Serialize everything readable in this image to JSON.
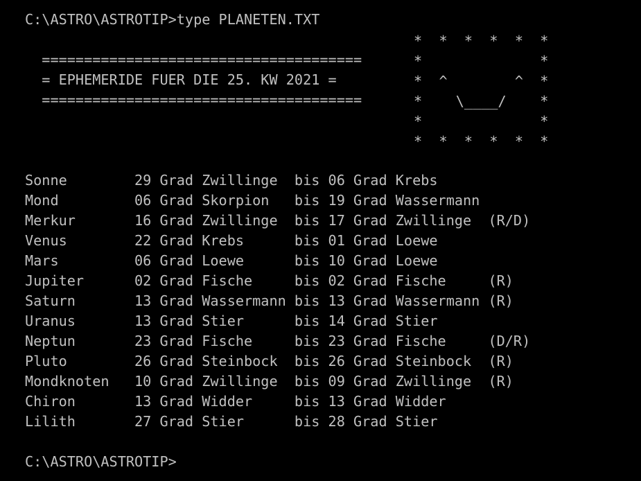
{
  "terminal": {
    "background_color": "#000000",
    "text_color": "#c0c0c0",
    "prompt_line": "C:\\ASTRO\\ASTROTIP>type PLANETEN.TXT",
    "trailing_prompt": "C:\\ASTRO\\ASTROTIP>"
  },
  "header": {
    "rule_top": "======================================",
    "title_line": "= EPHEMERIDE FUER DIE 25. KW 2021 =",
    "rule_bottom": "======================================",
    "title_text": "EPHEMERIDE FUER DIE 25. KW 2021",
    "week": "25. KW",
    "year": "2021"
  },
  "ascii_art": {
    "name": "smiley-face",
    "lines": [
      "*  *  *  *  *  *",
      "*              *",
      "*  ^        ^  *",
      "*   \\____/     *",
      "*              *",
      "*  *  *  *  *  *"
    ],
    "art_rows": [
      "*  *  *  *  *  *",
      "*              *",
      "*  ^        ^  *",
      "*    \\____/    *",
      "*              *",
      "*  *  *  *  *  *"
    ]
  },
  "table": {
    "unit_label": "Grad",
    "range_word": "bis",
    "rows": [
      {
        "body": "Sonne",
        "from_deg": "29",
        "from_sign": "Zwillinge",
        "to_deg": "06",
        "to_sign": "Krebs",
        "flag": ""
      },
      {
        "body": "Mond",
        "from_deg": "06",
        "from_sign": "Skorpion",
        "to_deg": "19",
        "to_sign": "Wassermann",
        "flag": ""
      },
      {
        "body": "Merkur",
        "from_deg": "16",
        "from_sign": "Zwillinge",
        "to_deg": "17",
        "to_sign": "Zwillinge",
        "flag": "(R/D)"
      },
      {
        "body": "Venus",
        "from_deg": "22",
        "from_sign": "Krebs",
        "to_deg": "01",
        "to_sign": "Loewe",
        "flag": ""
      },
      {
        "body": "Mars",
        "from_deg": "06",
        "from_sign": "Loewe",
        "to_deg": "10",
        "to_sign": "Loewe",
        "flag": ""
      },
      {
        "body": "Jupiter",
        "from_deg": "02",
        "from_sign": "Fische",
        "to_deg": "02",
        "to_sign": "Fische",
        "flag": "(R)"
      },
      {
        "body": "Saturn",
        "from_deg": "13",
        "from_sign": "Wassermann",
        "to_deg": "13",
        "to_sign": "Wassermann",
        "flag": "(R)"
      },
      {
        "body": "Uranus",
        "from_deg": "13",
        "from_sign": "Stier",
        "to_deg": "14",
        "to_sign": "Stier",
        "flag": ""
      },
      {
        "body": "Neptun",
        "from_deg": "23",
        "from_sign": "Fische",
        "to_deg": "23",
        "to_sign": "Fische",
        "flag": "(D/R)"
      },
      {
        "body": "Pluto",
        "from_deg": "26",
        "from_sign": "Steinbock",
        "to_deg": "26",
        "to_sign": "Steinbock",
        "flag": "(R)"
      },
      {
        "body": "Mondknoten",
        "from_deg": "10",
        "from_sign": "Zwillinge",
        "to_deg": "09",
        "to_sign": "Zwillinge",
        "flag": "(R)"
      },
      {
        "body": "Chiron",
        "from_deg": "13",
        "from_sign": "Widder",
        "to_deg": "13",
        "to_sign": "Widder",
        "flag": ""
      },
      {
        "body": "Lilith",
        "from_deg": "27",
        "from_sign": "Stier",
        "to_deg": "28",
        "to_sign": "Stier",
        "flag": ""
      }
    ]
  }
}
